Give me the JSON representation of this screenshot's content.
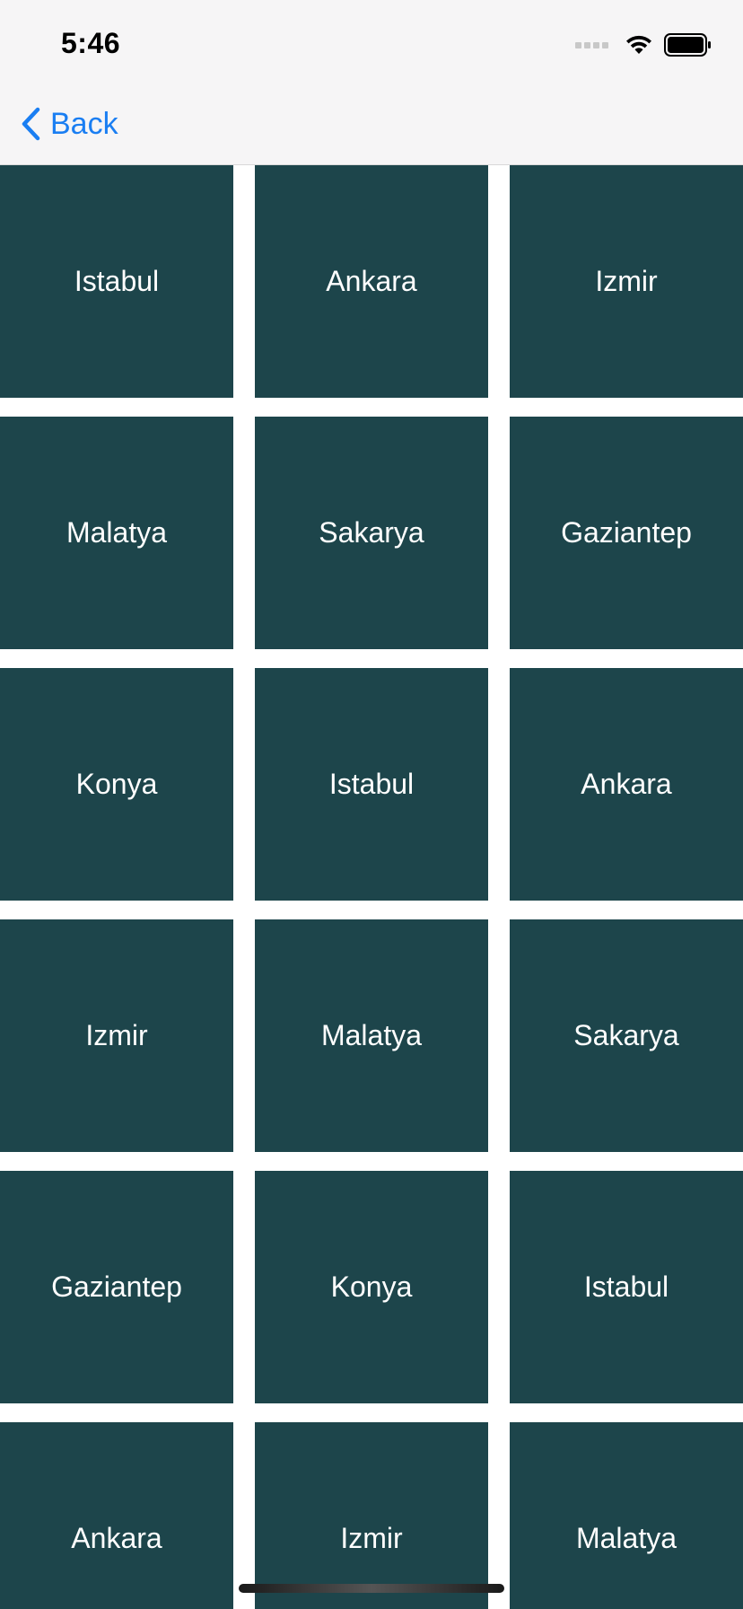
{
  "status_bar": {
    "time": "5:46",
    "icons": [
      "signal-dots-icon",
      "wifi-icon",
      "battery-icon"
    ]
  },
  "nav": {
    "back_label": "Back",
    "accent_color": "#1a7ef2"
  },
  "grid": {
    "tile_color": "#1d454b",
    "text_color": "#ffffff",
    "cells": [
      "Istabul",
      "Ankara",
      "Izmir",
      "Malatya",
      "Sakarya",
      "Gaziantep",
      "Konya",
      "Istabul",
      "Ankara",
      "Izmir",
      "Malatya",
      "Sakarya",
      "Gaziantep",
      "Konya",
      "Istabul",
      "Ankara",
      "Izmir",
      "Malatya"
    ]
  }
}
